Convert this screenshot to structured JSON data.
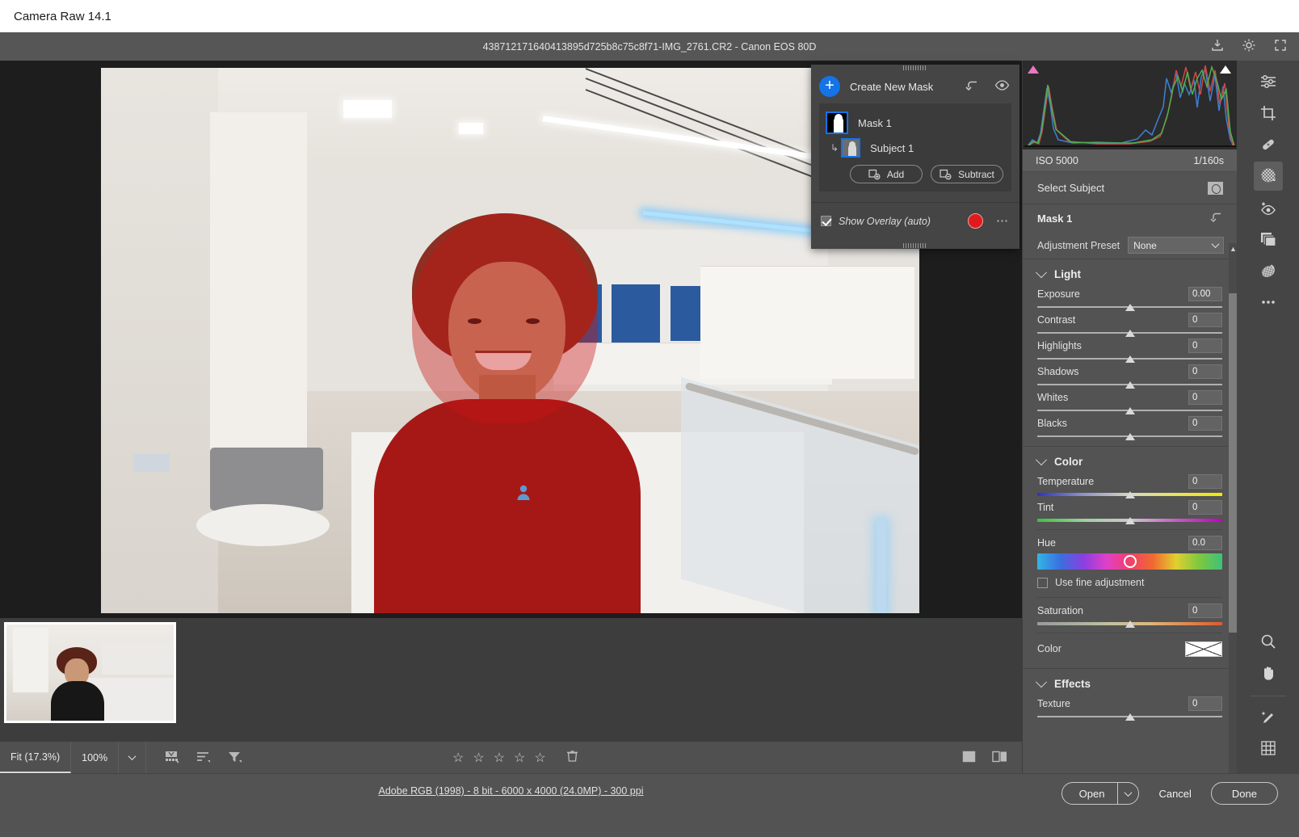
{
  "window": {
    "title": "Camera Raw 14.1"
  },
  "filebar": {
    "filename": "438712171640413895d725b8c75c8f71-IMG_2761.CR2  -  Canon EOS 80D",
    "icons": [
      "save-image-icon",
      "preferences-gear-icon",
      "fullscreen-icon"
    ]
  },
  "mask_panel": {
    "create_new_mask": "Create New Mask",
    "reset_icon": "undo-arrow-icon",
    "visibility_icon": "eye-icon",
    "masks": [
      {
        "name": "Mask 1",
        "thumb": "mask-thumbnail-icon"
      }
    ],
    "components": [
      {
        "name": "Subject 1",
        "thumb": "subject-thumbnail-icon"
      }
    ],
    "add_label": "Add",
    "subtract_label": "Subtract",
    "show_overlay_label": "Show Overlay (auto)",
    "show_overlay_checked": true,
    "overlay_color": "#e01b1b",
    "more_options_icon": "ellipsis-icon"
  },
  "right_panel": {
    "histogram": {
      "shadow_clip_icon": "shadow-clipping-warning",
      "highlight_clip_icon": "highlight-clipping-warning",
      "shadow_clip_color": "#e878c0",
      "highlight_clip_color": "#ffffff"
    },
    "exif": {
      "iso": "ISO 5000",
      "shutter": "1/160s"
    },
    "select_subject": {
      "label": "Select Subject",
      "icon": "select-subject-icon"
    },
    "mask_title": "Mask 1",
    "mask_reset_icon": "reset-icon",
    "adjustment_preset": {
      "label": "Adjustment Preset",
      "value": "None"
    },
    "sections": [
      {
        "title": "Light",
        "expanded": true,
        "sliders": [
          {
            "name": "Exposure",
            "value": "0.00",
            "pos": 50
          },
          {
            "name": "Contrast",
            "value": "0",
            "pos": 50
          },
          {
            "name": "Highlights",
            "value": "0",
            "pos": 50
          },
          {
            "name": "Shadows",
            "value": "0",
            "pos": 50
          },
          {
            "name": "Whites",
            "value": "0",
            "pos": 50
          },
          {
            "name": "Blacks",
            "value": "0",
            "pos": 50
          }
        ]
      },
      {
        "title": "Color",
        "expanded": true,
        "sliders": [
          {
            "name": "Temperature",
            "value": "0",
            "pos": 50
          },
          {
            "name": "Tint",
            "value": "0",
            "pos": 50
          }
        ],
        "hue": {
          "name": "Hue",
          "value": "0.0",
          "pos": 50
        },
        "fine_adjustment": {
          "label": "Use fine adjustment",
          "checked": false
        },
        "saturation": {
          "name": "Saturation",
          "value": "0",
          "pos": 50
        },
        "color": {
          "label": "Color",
          "swatch": "none"
        }
      },
      {
        "title": "Effects",
        "expanded": true,
        "sliders": [
          {
            "name": "Texture",
            "value": "0",
            "pos": 50
          }
        ]
      }
    ]
  },
  "vertical_toolbar": {
    "top_tools": [
      {
        "name": "edit-sliders-icon",
        "active": false
      },
      {
        "name": "crop-icon",
        "active": false
      },
      {
        "name": "healing-brush-icon",
        "active": false
      },
      {
        "name": "masking-icon",
        "active": true
      },
      {
        "name": "red-eye-icon",
        "active": false
      },
      {
        "name": "presets-icon",
        "active": false
      },
      {
        "name": "snapshots-icon",
        "active": false
      },
      {
        "name": "more-ellipsis-icon",
        "active": false
      }
    ],
    "bottom_tools": [
      {
        "name": "zoom-tool-icon",
        "active": false
      },
      {
        "name": "hand-tool-icon",
        "active": false
      },
      {
        "name": "white-balance-tool-icon",
        "active": false
      },
      {
        "name": "grid-overlay-icon",
        "active": false
      }
    ]
  },
  "filmstrip": {
    "thumbnails": [
      {
        "name": "IMG_2761",
        "selected": true
      }
    ]
  },
  "bottom_bar": {
    "zoom_fit": "Fit (17.3%)",
    "zoom_100": "100%",
    "zoom_dropdown_icon": "chevron-down-icon",
    "tools": [
      "filmstrip-view-icon",
      "sort-order-icon",
      "filter-icon"
    ],
    "rating_stars": 5,
    "delete_icon": "trash-icon",
    "view_single_icon": "single-view-icon",
    "view_compare_icon": "compare-view-icon"
  },
  "footer": {
    "info": "Adobe RGB (1998) - 8 bit - 6000 x 4000 (24.0MP) - 300 ppi",
    "open_label": "Open",
    "open_dropdown_icon": "chevron-down-icon",
    "cancel_label": "Cancel",
    "done_label": "Done"
  },
  "colors": {
    "accent": "#1473e6",
    "panel": "#535353",
    "overlay": "#e01b1b"
  }
}
